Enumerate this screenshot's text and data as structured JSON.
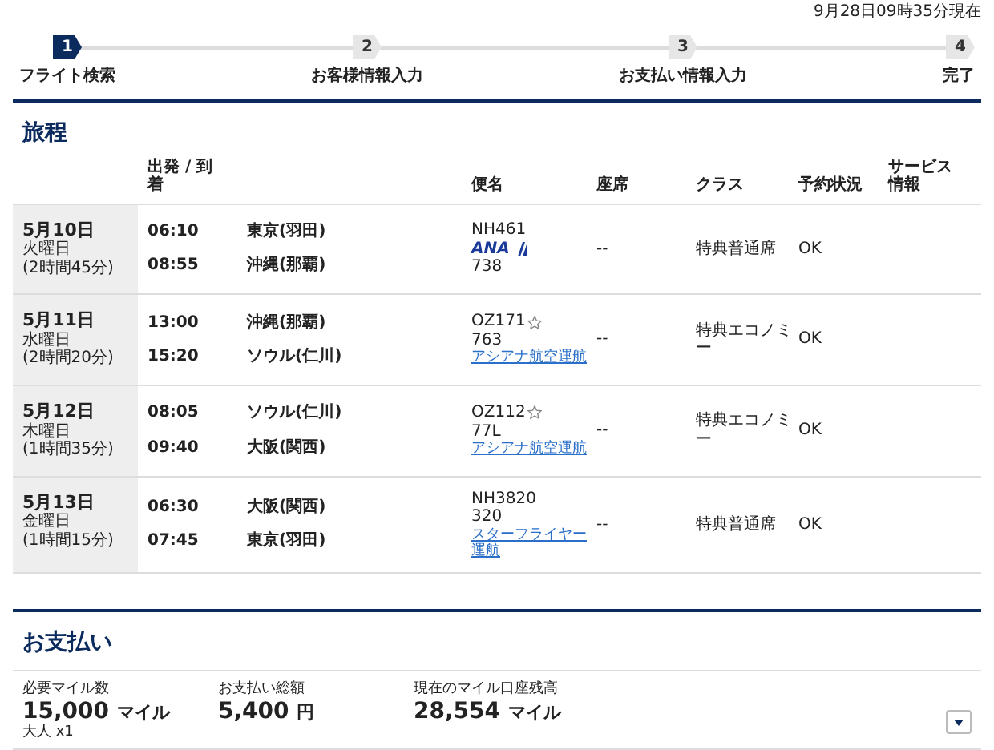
{
  "timestamp": "9月28日09時35分現在",
  "steps": [
    {
      "number": "1",
      "label": "フライト検索",
      "selected": true
    },
    {
      "number": "2",
      "label": "お客様情報入力",
      "selected": false
    },
    {
      "number": "3",
      "label": "お支払い情報入力",
      "selected": false
    },
    {
      "number": "4",
      "label": "完了",
      "selected": false
    }
  ],
  "itinerary": {
    "title": "旅程",
    "columns": [
      "出発 / 到着",
      "便名",
      "座席",
      "クラス",
      "予約状況",
      "サービス情報"
    ],
    "rows": [
      {
        "date": "5月10日",
        "weekday": "火曜日",
        "duration": "(2時間45分)",
        "dep_time": "06:10",
        "dep_place": "東京(羽田)",
        "arr_time": "08:55",
        "arr_place": "沖縄(那覇)",
        "flight": "NH461",
        "star": false,
        "logo": "ANA",
        "aircraft": "738",
        "seat": "--",
        "class": "特典普通席",
        "status": "OK"
      },
      {
        "date": "5月11日",
        "weekday": "水曜日",
        "duration": "(2時間20分)",
        "dep_time": "13:00",
        "dep_place": "沖縄(那覇)",
        "arr_time": "15:20",
        "arr_place": "ソウル(仁川)",
        "flight": "OZ171",
        "star": true,
        "aircraft": "763",
        "operator": "アシアナ航空運航",
        "seat": "--",
        "class": "特典エコノミー",
        "status": "OK"
      },
      {
        "date": "5月12日",
        "weekday": "木曜日",
        "duration": "(1時間35分)",
        "dep_time": "08:05",
        "dep_place": "ソウル(仁川)",
        "arr_time": "09:40",
        "arr_place": "大阪(関西)",
        "flight": "OZ112",
        "star": true,
        "aircraft": "77L",
        "operator": "アシアナ航空運航",
        "seat": "--",
        "class": "特典エコノミー",
        "status": "OK"
      },
      {
        "date": "5月13日",
        "weekday": "金曜日",
        "duration": "(1時間15分)",
        "dep_time": "06:30",
        "dep_place": "大阪(関西)",
        "arr_time": "07:45",
        "arr_place": "東京(羽田)",
        "flight": "NH3820",
        "star": false,
        "aircraft": "320",
        "operator": "スターフライヤー運航",
        "seat": "--",
        "class": "特典普通席",
        "status": "OK"
      }
    ]
  },
  "payment": {
    "title": "お支払い",
    "items": [
      {
        "label": "必要マイル数",
        "value": "15,000",
        "unit": "マイル",
        "note": "大人 x1"
      },
      {
        "label": "お支払い総額",
        "value": "5,400",
        "unit": "円"
      },
      {
        "label": "現在のマイル口座残高",
        "value": "28,554",
        "unit": "マイル"
      }
    ]
  }
}
